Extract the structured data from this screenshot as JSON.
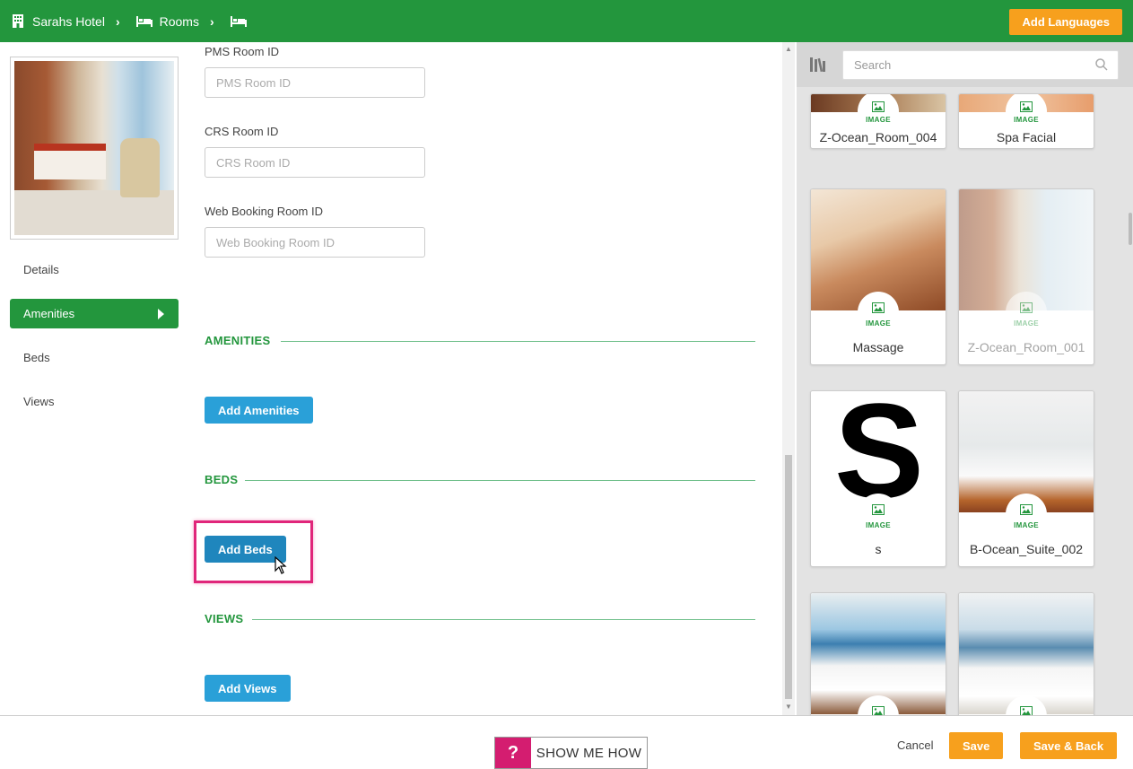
{
  "header": {
    "breadcrumb": [
      {
        "label": "Sarahs Hotel",
        "icon": "building-icon"
      },
      {
        "label": "Rooms",
        "icon": "bed-icon"
      },
      {
        "label": "",
        "icon": "bed-icon"
      }
    ],
    "add_languages_label": "Add Languages"
  },
  "sidebar": {
    "items": [
      {
        "label": "Details",
        "active": false
      },
      {
        "label": "Amenities",
        "active": true
      },
      {
        "label": "Beds",
        "active": false
      },
      {
        "label": "Views",
        "active": false
      }
    ]
  },
  "form": {
    "pms": {
      "label": "PMS Room ID",
      "placeholder": "PMS Room ID",
      "value": ""
    },
    "crs": {
      "label": "CRS Room ID",
      "placeholder": "CRS Room ID",
      "value": ""
    },
    "web": {
      "label": "Web Booking Room ID",
      "placeholder": "Web Booking Room ID",
      "value": ""
    }
  },
  "sections": {
    "amenities": {
      "title": "AMENITIES",
      "button": "Add Amenities"
    },
    "beds": {
      "title": "BEDS",
      "button": "Add Beds"
    },
    "views": {
      "title": "VIEWS",
      "button": "Add Views"
    }
  },
  "media": {
    "search_placeholder": "Search",
    "badge_label": "IMAGE",
    "cards": [
      {
        "name": "Z-Ocean_Room_004"
      },
      {
        "name": "Spa Facial"
      },
      {
        "name": "Massage"
      },
      {
        "name": "Z-Ocean_Room_001",
        "dimmed": true
      },
      {
        "name": "s"
      },
      {
        "name": "B-Ocean_Suite_002"
      },
      {
        "name": ""
      },
      {
        "name": ""
      }
    ]
  },
  "footer": {
    "show_me_q": "?",
    "show_me_how": "SHOW ME HOW",
    "cancel": "Cancel",
    "save": "Save",
    "save_back": "Save & Back"
  },
  "colors": {
    "brand_green": "#23963d",
    "accent_orange": "#f7a01d",
    "button_blue": "#2aa0d8",
    "highlight_pink": "#e0267a"
  }
}
